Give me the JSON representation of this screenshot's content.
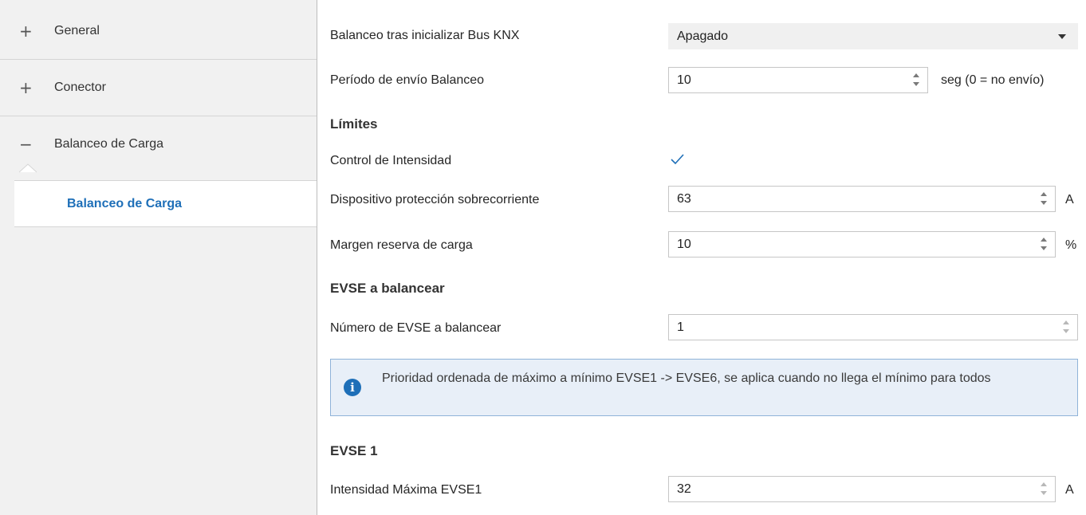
{
  "sidebar": {
    "items": [
      {
        "sign": "+",
        "label": "General"
      },
      {
        "sign": "+",
        "label": "Conector"
      },
      {
        "sign": "−",
        "label": "Balanceo de Carga"
      }
    ],
    "sub_item": {
      "label": "Balanceo de Carga"
    }
  },
  "main": {
    "bus_init": {
      "label": "Balanceo tras inicializar Bus KNX",
      "value": "Apagado"
    },
    "period": {
      "label": "Período de envío Balanceo",
      "value": "10",
      "unit": "seg (0 = no envío)"
    },
    "limits_section": "Límites",
    "current_control": {
      "label": "Control de Intensidad",
      "checked": true
    },
    "overcurrent": {
      "label": "Dispositivo protección sobrecorriente",
      "value": "63",
      "unit": "A"
    },
    "reserve": {
      "label": "Margen reserva de carga",
      "value": "10",
      "unit": "%"
    },
    "evse_section": "EVSE a balancear",
    "evse_count": {
      "label": "Número de EVSE a balancear",
      "value": "1"
    },
    "info": {
      "text": "Prioridad ordenada de máximo a mínimo EVSE1 -> EVSE6, se aplica cuando no llega el mínimo para todos",
      "icon": "info-icon"
    },
    "evse1_section": "EVSE 1",
    "evse1_max": {
      "label": "Intensidad Máxima EVSE1",
      "value": "32",
      "unit": "A"
    }
  },
  "colors": {
    "accent": "#1e6fb8",
    "sidebar_bg": "#f1f1f1",
    "info_bg": "#e8eff8"
  }
}
